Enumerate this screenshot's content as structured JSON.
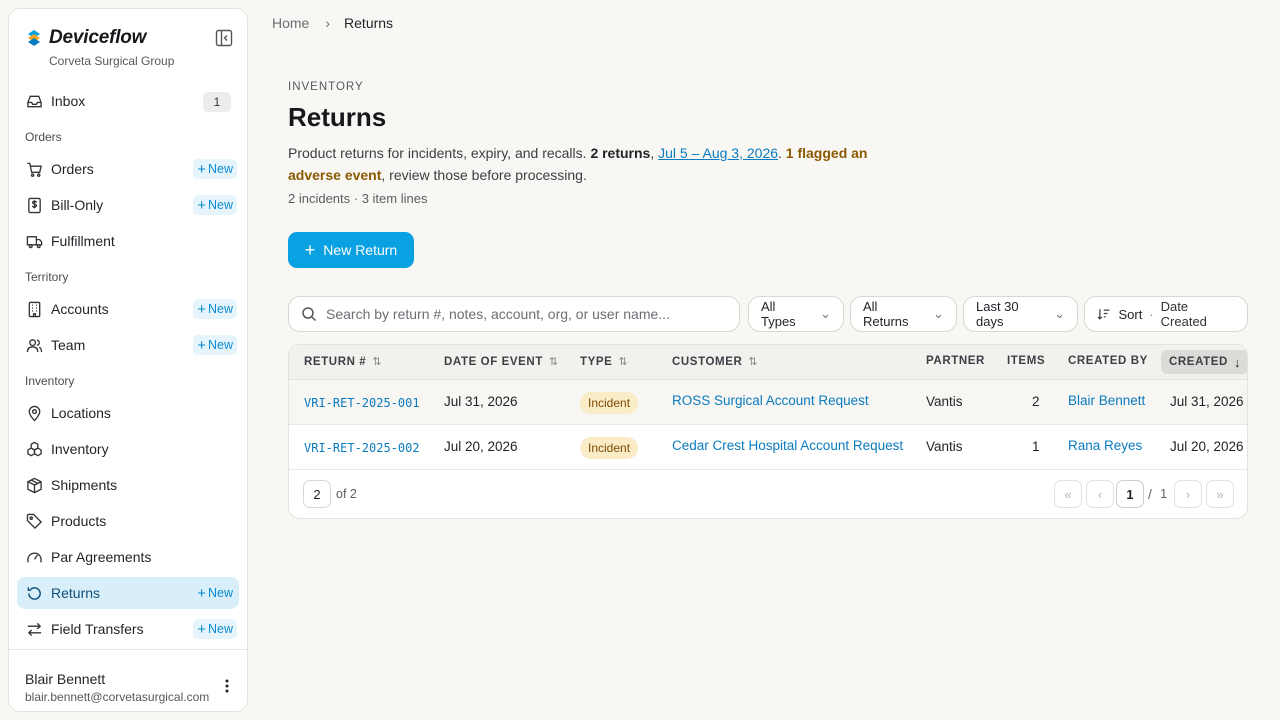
{
  "sidebar": {
    "brand": "Deviceflow",
    "org": "Corveta Surgical Group",
    "inbox": {
      "label": "Inbox",
      "count": "1"
    },
    "sections": [
      {
        "label": "Orders"
      },
      {
        "label": "Territory"
      },
      {
        "label": "Inventory"
      }
    ],
    "items": [
      {
        "label": "Orders",
        "new": "New"
      },
      {
        "label": "Bill-Only",
        "new": "New"
      },
      {
        "label": "Fulfillment"
      },
      {
        "label": "Accounts",
        "new": "New"
      },
      {
        "label": "Team",
        "new": "New"
      },
      {
        "label": "Locations"
      },
      {
        "label": "Inventory"
      },
      {
        "label": "Shipments"
      },
      {
        "label": "Products"
      },
      {
        "label": "Par Agreements"
      },
      {
        "label": "Returns",
        "new": "New",
        "active": true
      },
      {
        "label": "Field Transfers",
        "new": "New"
      }
    ],
    "user": {
      "name": "Blair Bennett",
      "email": "blair.bennett@corvetasurgical.com"
    }
  },
  "breadcrumb": {
    "home": "Home",
    "current": "Returns"
  },
  "header": {
    "eyebrow": "INVENTORY",
    "title": "Returns",
    "desc_intro": "Product returns for incidents, expiry, and recalls. ",
    "desc_count": "2 returns",
    "desc_comma": ", ",
    "desc_range": "Jul 5 – Aug 3, 2026",
    "desc_dot": ". ",
    "desc_flag": "1 flagged an adverse event",
    "desc_tail": ", review those before processing.",
    "meta": "2 incidents · 3 item lines"
  },
  "actions": {
    "new_return": "New Return"
  },
  "filters": {
    "search_placeholder": "Search by return #, notes, account, org, or user name...",
    "type": "All Types",
    "scope": "All Returns",
    "range": "Last 30 days",
    "sort_label": "Sort",
    "sort_sep": "·",
    "sort_value": "Date Created"
  },
  "table": {
    "columns": [
      "RETURN #",
      "DATE OF EVENT",
      "TYPE",
      "CUSTOMER",
      "PARTNER",
      "ITEMS",
      "CREATED BY",
      "CREATED"
    ],
    "rows": [
      {
        "id": "VRI-RET-2025-001",
        "event_date": "Jul 31, 2026",
        "type": "Incident",
        "customer": "ROSS Surgical Account Request",
        "partner": "Vantis",
        "items": "2",
        "created_by": "Blair Bennett",
        "created": "Jul 31, 2026"
      },
      {
        "id": "VRI-RET-2025-002",
        "event_date": "Jul 20, 2026",
        "type": "Incident",
        "customer": "Cedar Crest Hospital Account Request",
        "partner": "Vantis",
        "items": "1",
        "created_by": "Rana Reyes",
        "created": "Jul 20, 2026"
      }
    ],
    "page_size": "2",
    "of_total": "of 2",
    "page": "1",
    "page_sep": "/",
    "pages": "1"
  },
  "colors": {
    "accent": "#0aa1e2",
    "active_nav": "#d8eef9",
    "badge_bg": "#fbecc8"
  }
}
